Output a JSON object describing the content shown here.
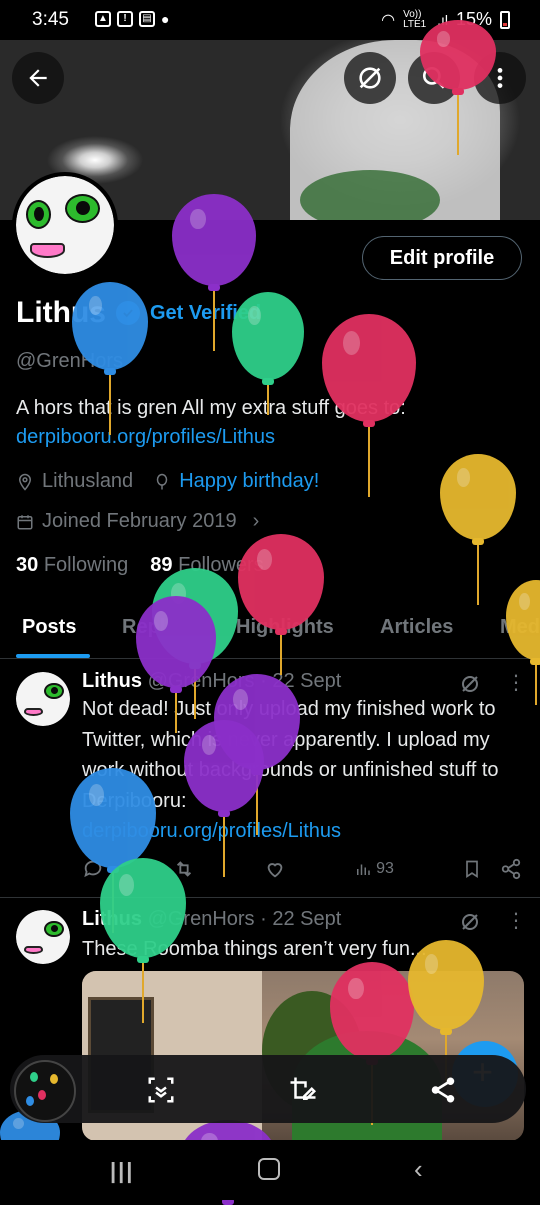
{
  "status_bar": {
    "time": "3:45",
    "network": "Vo)) LTE1",
    "battery": "15%"
  },
  "header": {
    "back_icon": "arrow-left-icon",
    "actions": [
      "grok-icon",
      "search-icon",
      "more-vertical-icon"
    ]
  },
  "profile": {
    "edit_label": "Edit profile",
    "name": "Lithus",
    "get_verified": "Get Verified",
    "handle": "@GrenHors",
    "bio_text": "A hors that is gren  All my extra stuff goes to:",
    "bio_link": "derpibooru.org/profiles/Lithus",
    "location": "Lithusland",
    "birthday": "Happy birthday!",
    "joined": "Joined February 2019",
    "following_count": "30",
    "following_label": "Following",
    "followers_count": "89",
    "followers_label": "Followers"
  },
  "tabs": [
    "Posts",
    "Replies",
    "Highlights",
    "Articles",
    "Media"
  ],
  "posts": [
    {
      "author": "Lithus",
      "handle": "@GrenHors",
      "date": "· 22 Sept",
      "text": "Not dead! Just only upload my finished work to Twitter, which is never apparently. I upload my work without backgrounds or unfinished stuff to Derpibooru:",
      "link": "derpibooru.org/profiles/Lithus",
      "views": "93"
    },
    {
      "author": "Lithus",
      "handle": "@GrenHors",
      "date": "· 22 Sept",
      "text": "These Roomba things aren’t very fun..."
    }
  ],
  "colors": {
    "accent": "#1d9bf0",
    "balloon_purple": "#8b2fc9",
    "balloon_blue": "#2f8de4",
    "balloon_green": "#2fcf8a",
    "balloon_red": "#e03060",
    "balloon_yellow": "#e6b82e"
  }
}
